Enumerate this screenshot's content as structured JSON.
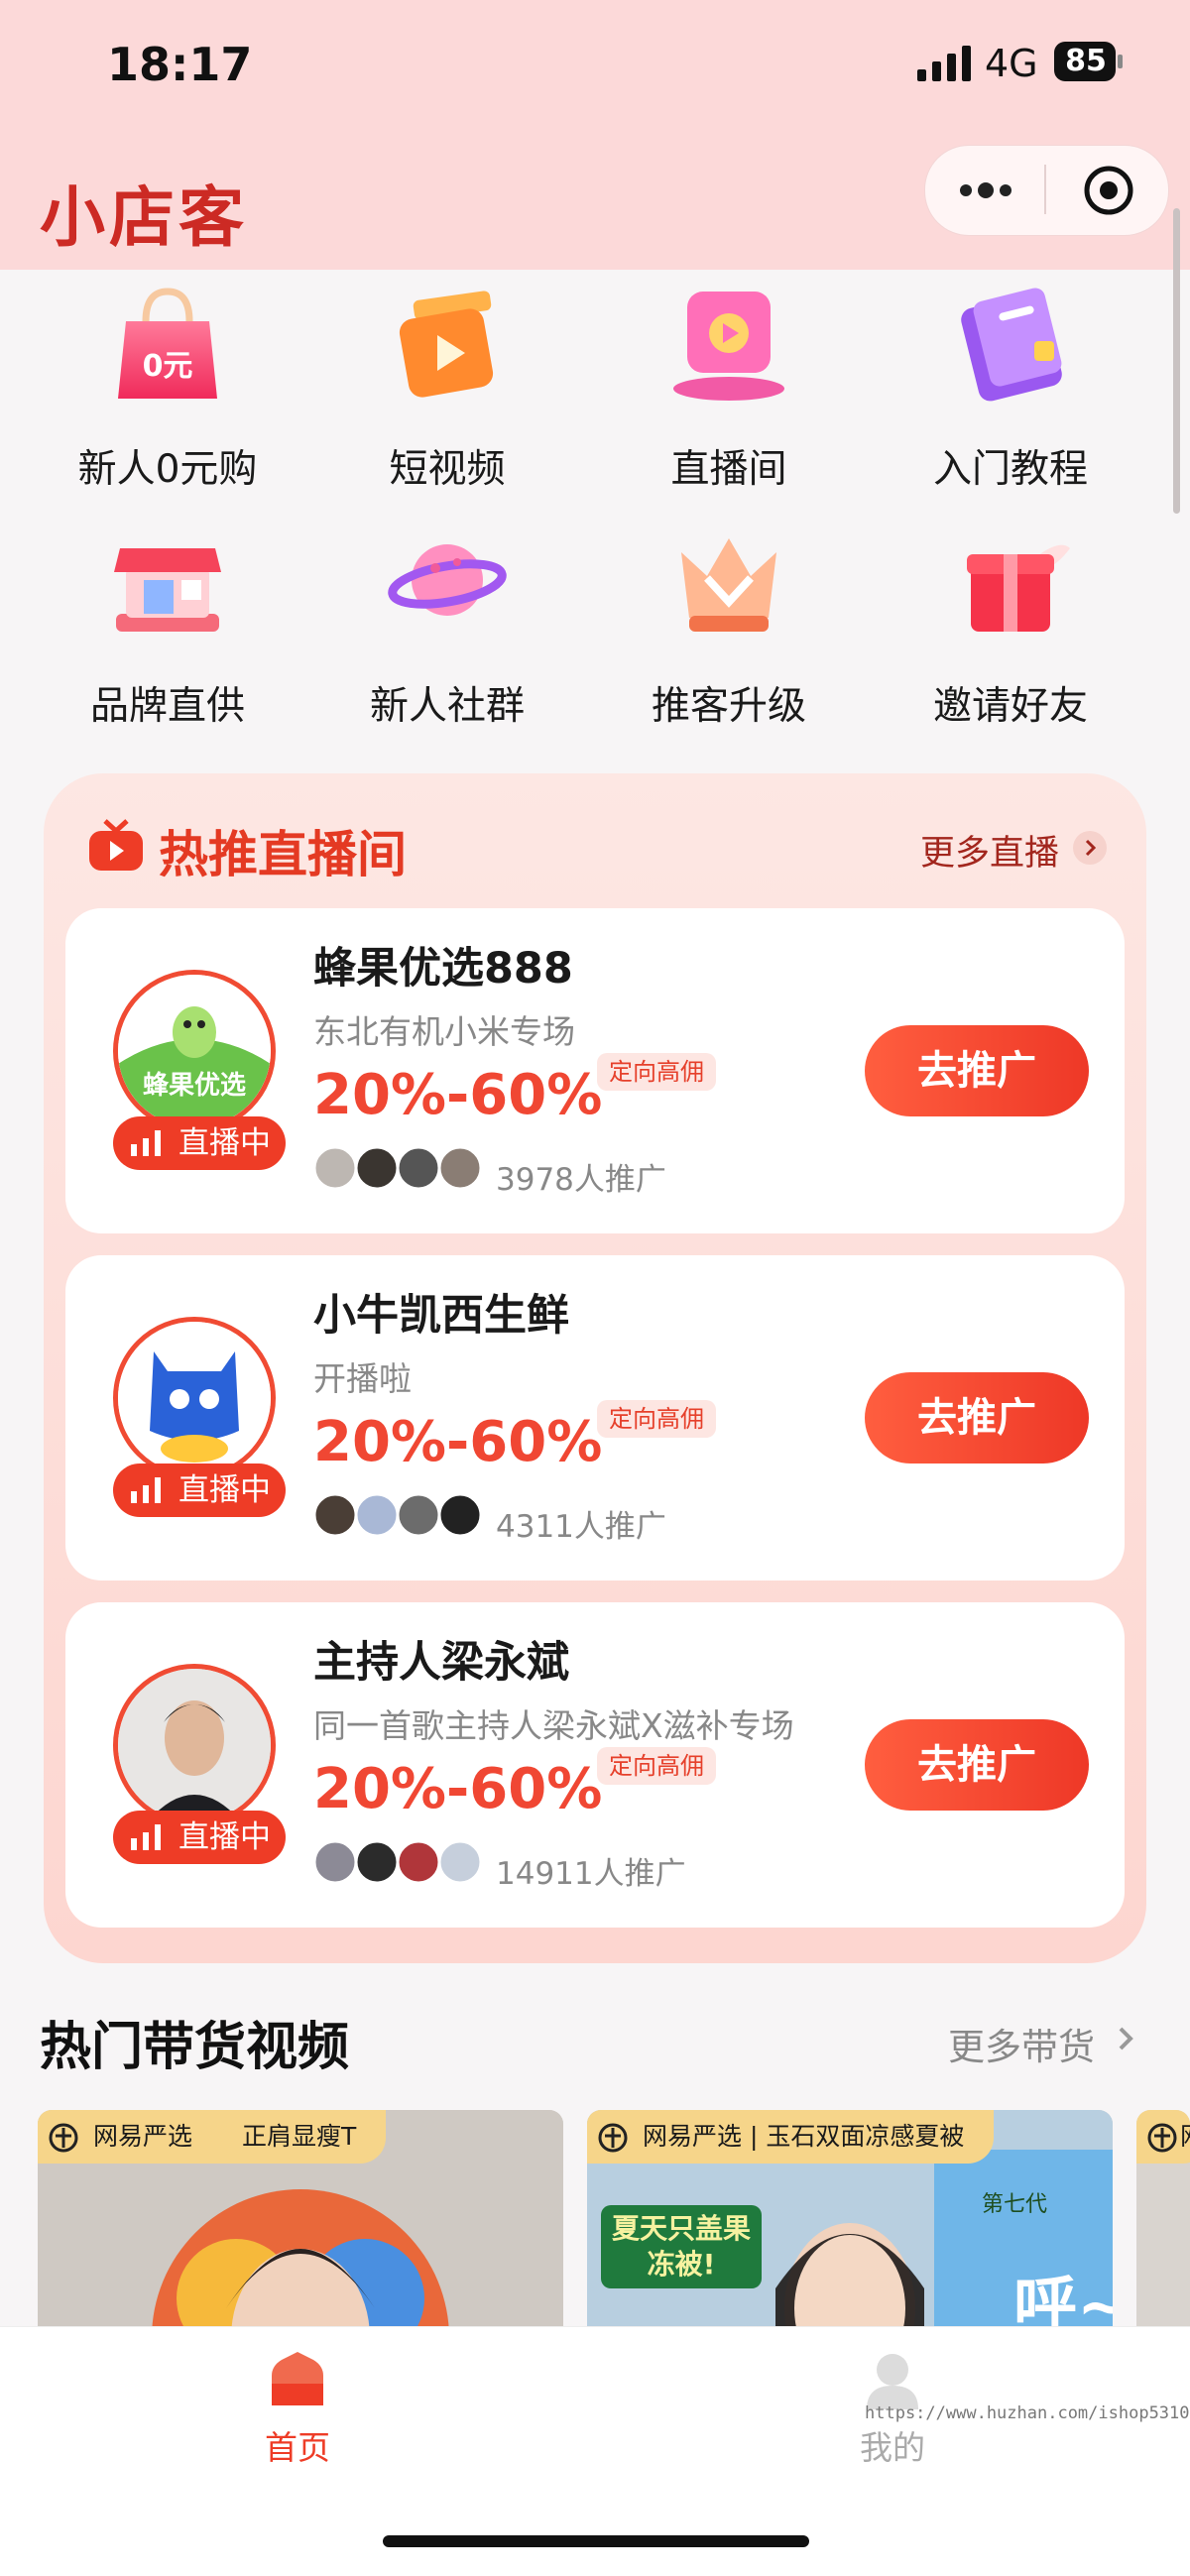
{
  "status_bar": {
    "time": "18:17",
    "network": "4G",
    "battery": "85"
  },
  "header": {
    "title": "小店客"
  },
  "grid": [
    {
      "label": "新人0元购",
      "icon": "shopping-bag-icon"
    },
    {
      "label": "短视频",
      "icon": "video-play-icon"
    },
    {
      "label": "直播间",
      "icon": "live-room-icon"
    },
    {
      "label": "入门教程",
      "icon": "tutorial-book-icon"
    },
    {
      "label": "品牌直供",
      "icon": "store-icon"
    },
    {
      "label": "新人社群",
      "icon": "planet-icon"
    },
    {
      "label": "推客升级",
      "icon": "crown-icon"
    },
    {
      "label": "邀请好友",
      "icon": "gift-icon"
    }
  ],
  "bag_text": "0元",
  "hot_live": {
    "title": "热推直播间",
    "more": "更多直播",
    "badge": "直播中",
    "tag": "定向高佣",
    "button": "去推广",
    "items": [
      {
        "name": "蜂果优选888",
        "subtitle": "东北有机小米专场",
        "commission": "20%-60%",
        "promoters": "3978人推广",
        "avatar_text": "蜂果优选"
      },
      {
        "name": "小牛凯西生鲜",
        "subtitle": "开播啦",
        "commission": "20%-60%",
        "promoters": "4311人推广"
      },
      {
        "name": "主持人梁永斌",
        "subtitle": "同一首歌主持人梁永斌X滋补专场",
        "commission": "20%-60%",
        "promoters": "14911人推广"
      }
    ]
  },
  "videos": {
    "title": "热门带货视频",
    "more": "更多带货",
    "items": [
      {
        "brand": "网易严选",
        "caption": "正肩显瘦T"
      },
      {
        "brand": "网易严选",
        "caption": "玉石双面凉感夏被",
        "sticker": "夏天只盖果冻被!",
        "overlay": "第七代",
        "big": "呼~"
      },
      {
        "brand": "网"
      }
    ]
  },
  "tabbar": {
    "home": "首页",
    "me": "我的"
  },
  "watermark": "https://www.huzhan.com/ishop53105",
  "colors": {
    "accent": "#ee3c26",
    "header_bg": "#fcd9d9",
    "brand": "#cc2a24"
  }
}
